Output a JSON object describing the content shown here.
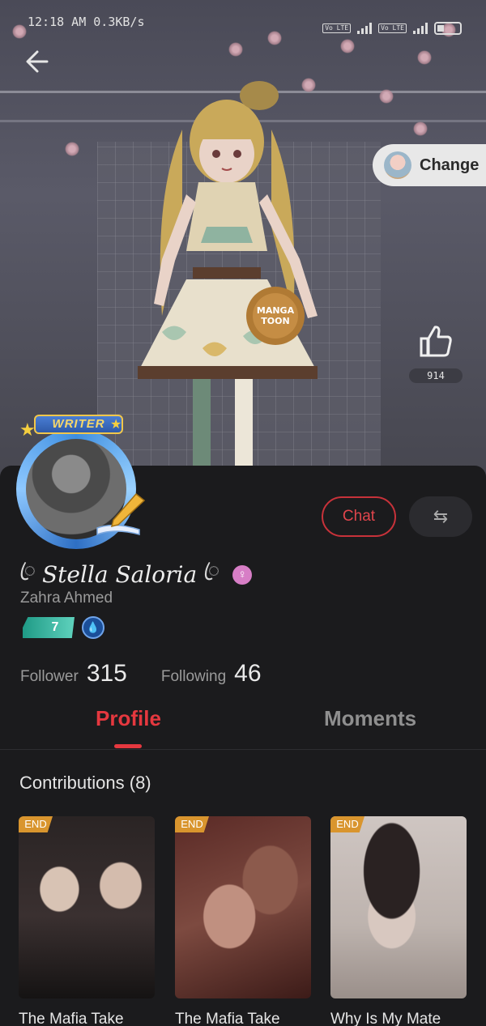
{
  "status_bar": {
    "time": "12:18 AM",
    "speed": "0.3KB/s",
    "lte_label": "Vo LTE"
  },
  "hero": {
    "change_label": "Change",
    "like_count": "914",
    "bag_text": "MANGA TOON"
  },
  "profile": {
    "writer_badge": "WRITER",
    "display_name": "Stella Saloria",
    "username": "Zahra Ahmed",
    "level": "7",
    "chat_label": "Chat",
    "swap_icon": "⇆",
    "gender_icon": "female-icon"
  },
  "stats": {
    "follower_label": "Follower",
    "follower_count": "315",
    "following_label": "Following",
    "following_count": "46"
  },
  "tabs": {
    "profile": "Profile",
    "moments": "Moments"
  },
  "contributions": {
    "title": "Contributions (8)",
    "items": [
      {
        "badge": "END",
        "title": "The Mafia Take"
      },
      {
        "badge": "END",
        "title": "The Mafia Take"
      },
      {
        "badge": "END",
        "title": "Why Is My Mate"
      }
    ]
  },
  "colors": {
    "accent": "#e5383f",
    "badge_end": "#d9952e"
  }
}
